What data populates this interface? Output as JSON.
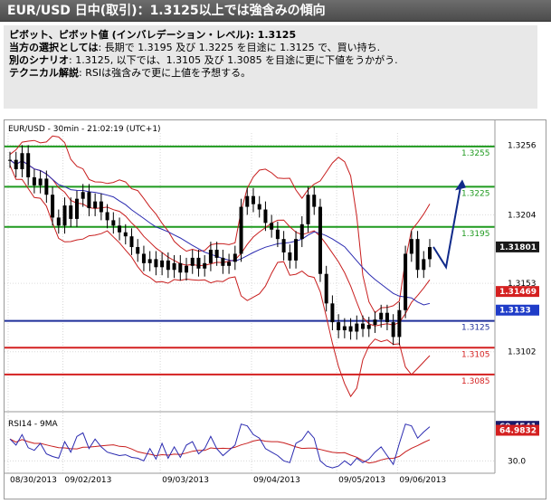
{
  "header": {
    "title": "EUR/USD 日中(取引)：1.3125以上では強含みの傾向"
  },
  "analysis": {
    "pivot_label": "ピボット、ピボット値 (インバレデーション・レベル): 1.3125",
    "preferred_label": "当方の選択としては",
    "preferred_text": ": 長期で 1.3195 及び 1.3225 を目途に 1.3125 で、買い持ち.",
    "alt_label": "別のシナリオ",
    "alt_text": ": 1.3125, 以下では、1.3105 及び 1.3085 を目途に更に下値をうかがう.",
    "tech_label": "テクニカル解説",
    "tech_text": ": RSIは強含みで更に上値を予想する。"
  },
  "colors": {
    "green_level": "#1f9a1f",
    "blue_level": "#1f2f9a",
    "red_level": "#d42020",
    "candle": "#000000",
    "bollinger": "#c81e1e",
    "ma": "#2a2ab0",
    "arrow": "#102a8a",
    "badge_current": "#1a1a1a",
    "badge_blue": "#1f3cc8",
    "badge_red": "#d42020",
    "badge_rsi": "#1a1a6a"
  },
  "chart_data": [
    {
      "type": "line",
      "subtype": "candlestick-with-bollinger",
      "title": "EUR/USD - 30min - 21:02:19 (UTC+1)",
      "ylim": [
        1.306,
        1.3265
      ],
      "y_ticks": [
        "1.3256",
        "1.3204",
        "1.3153",
        "1.3102"
      ],
      "y_tick_values": [
        1.3256,
        1.3204,
        1.3153,
        1.3102
      ],
      "x_ticks": [
        "08/30/2013",
        "09/02/2013",
        "09/03/2013",
        "09/04/2013",
        "09/05/2013",
        "09/06/2013"
      ],
      "current_price": "1.31801",
      "current_value": 1.31801,
      "lower_band_label": "1.31469",
      "lower_band_value": 1.31469,
      "blue_badge_label": "1.3133",
      "blue_badge_value": 1.3133,
      "levels": [
        {
          "label": "1.3255",
          "value": 1.3255,
          "color": "green"
        },
        {
          "label": "1.3225",
          "value": 1.3225,
          "color": "green"
        },
        {
          "label": "1.3195",
          "value": 1.3195,
          "color": "green"
        },
        {
          "label": "1.3125",
          "value": 1.3125,
          "color": "blue"
        },
        {
          "label": "1.3105",
          "value": 1.3105,
          "color": "red"
        },
        {
          "label": "1.3085",
          "value": 1.3085,
          "color": "red"
        }
      ],
      "close_series": [
        1.3245,
        1.3238,
        1.325,
        1.3232,
        1.3226,
        1.3231,
        1.3219,
        1.3202,
        1.3196,
        1.3211,
        1.3201,
        1.3216,
        1.3221,
        1.3209,
        1.3214,
        1.3206,
        1.32,
        1.3196,
        1.3191,
        1.3188,
        1.318,
        1.3175,
        1.3168,
        1.3171,
        1.3165,
        1.317,
        1.3163,
        1.3168,
        1.3161,
        1.3166,
        1.3172,
        1.3164,
        1.3168,
        1.3178,
        1.3172,
        1.3166,
        1.3169,
        1.3175,
        1.321,
        1.3218,
        1.3212,
        1.3208,
        1.3198,
        1.3193,
        1.3186,
        1.3176,
        1.317,
        1.3186,
        1.3197,
        1.3219,
        1.321,
        1.316,
        1.3138,
        1.3124,
        1.3118,
        1.3121,
        1.3117,
        1.3123,
        1.3119,
        1.3122,
        1.3126,
        1.3131,
        1.3124,
        1.3113,
        1.3133,
        1.3175,
        1.3186,
        1.3163,
        1.3171,
        1.318
      ]
    },
    {
      "type": "line",
      "title": "RSI14 - 9MA",
      "ylim": [
        20,
        80
      ],
      "y_ticks": [
        "30.0"
      ],
      "y_tick_values": [
        30
      ],
      "rsi_label": "69.4541",
      "rsi_value": 69.4541,
      "ma_label": "64.9832",
      "ma_value": 64.9832,
      "rsi_series": [
        55,
        48,
        60,
        45,
        42,
        50,
        38,
        35,
        33,
        52,
        40,
        58,
        62,
        44,
        55,
        46,
        40,
        38,
        36,
        37,
        34,
        33,
        30,
        44,
        32,
        50,
        33,
        46,
        34,
        48,
        52,
        38,
        44,
        58,
        44,
        36,
        42,
        48,
        72,
        70,
        60,
        56,
        44,
        40,
        36,
        30,
        28,
        50,
        54,
        64,
        56,
        30,
        24,
        22,
        24,
        30,
        25,
        33,
        28,
        32,
        40,
        46,
        36,
        26,
        50,
        72,
        70,
        56,
        63,
        69
      ]
    }
  ]
}
